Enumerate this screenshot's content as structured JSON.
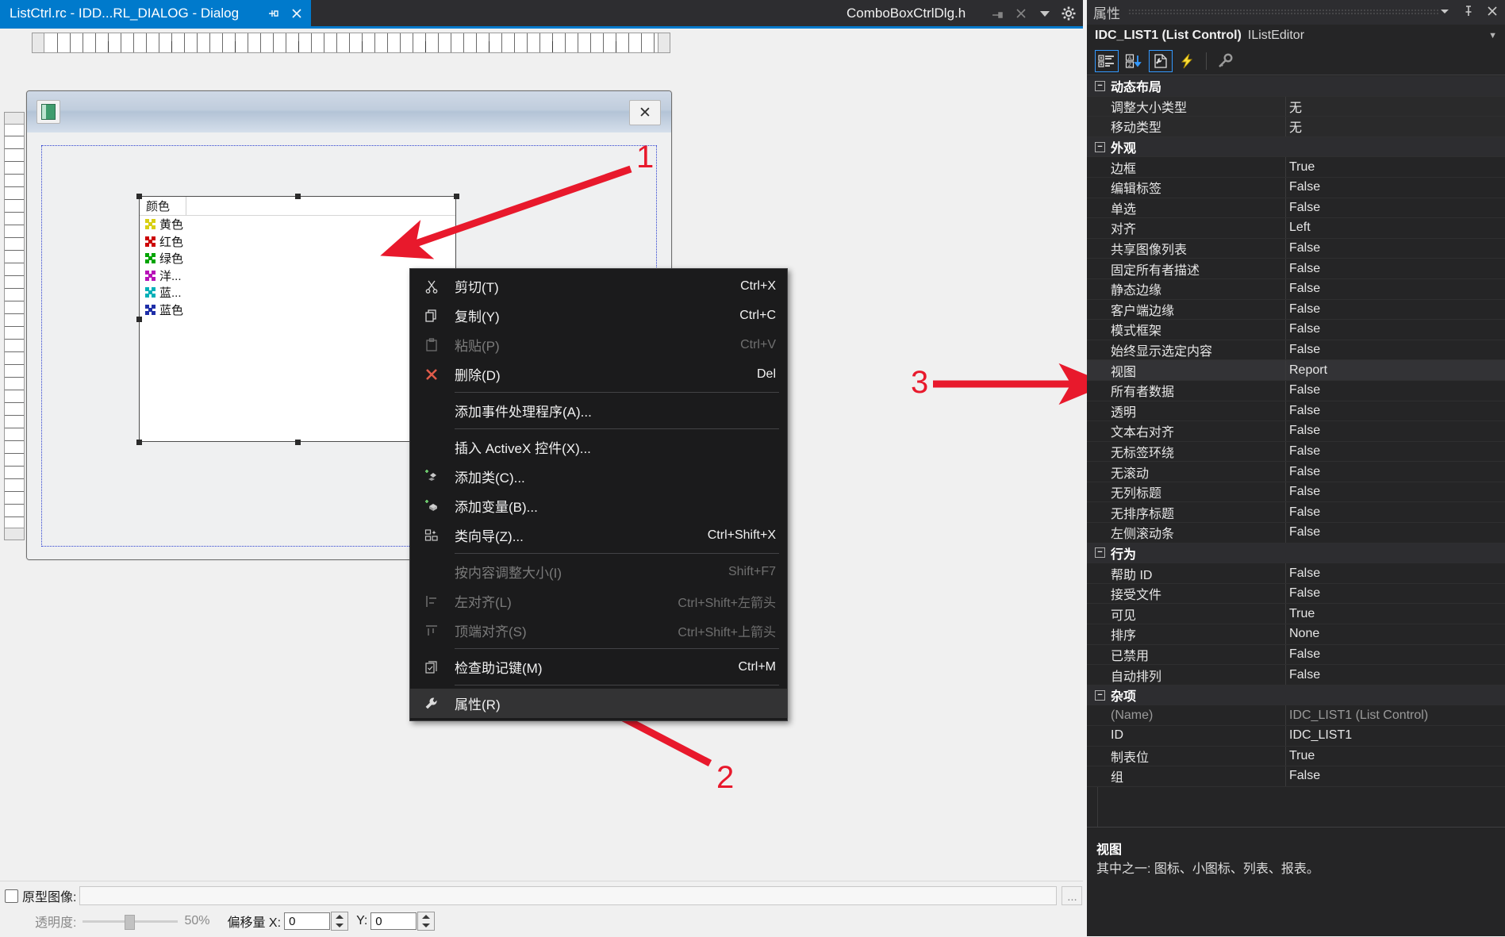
{
  "tabs": {
    "active": {
      "label": "ListCtrl.rc - IDD...RL_DIALOG - Dialog",
      "pin_icon": "pin-icon",
      "close_icon": "close-icon"
    },
    "inactive": {
      "label": "ComboBoxCtrlDlg.h",
      "pin_icon": "pin-icon",
      "close_icon": "close-icon",
      "dropdown_icon": "chevron-down-icon",
      "settings_icon": "gear-icon"
    }
  },
  "designer": {
    "dialog": {
      "system_icon": "app-icon",
      "close_button": "close-icon",
      "list_control": {
        "header": "颜色",
        "rows": [
          {
            "icon": "color-swatch-icon",
            "color": "#d8cf15",
            "label": "黄色"
          },
          {
            "icon": "color-swatch-icon",
            "color": "#cc0000",
            "label": "红色"
          },
          {
            "icon": "color-swatch-icon",
            "color": "#00a400",
            "label": "绿色"
          },
          {
            "icon": "color-swatch-icon",
            "color": "#b812b8",
            "label": "洋..."
          },
          {
            "icon": "color-swatch-icon",
            "color": "#00b0b8",
            "label": "蓝..."
          },
          {
            "icon": "color-swatch-icon",
            "color": "#1f2fa8",
            "label": "蓝色"
          }
        ]
      }
    },
    "annotations": [
      {
        "number": "1",
        "target": "list-control"
      },
      {
        "number": "2",
        "target": "context-menu-properties"
      },
      {
        "number": "3",
        "target": "view-property-row"
      }
    ]
  },
  "context_menu": {
    "items": [
      {
        "icon": "cut-icon",
        "label": "剪切(T)",
        "shortcut": "Ctrl+X",
        "disabled": false,
        "sep_after": false
      },
      {
        "icon": "copy-icon",
        "label": "复制(Y)",
        "shortcut": "Ctrl+C",
        "disabled": false,
        "sep_after": false
      },
      {
        "icon": "paste-icon",
        "label": "粘贴(P)",
        "shortcut": "Ctrl+V",
        "disabled": true,
        "sep_after": false
      },
      {
        "icon": "delete-x-icon",
        "label": "删除(D)",
        "shortcut": "Del",
        "disabled": false,
        "sep_after": true
      },
      {
        "icon": "",
        "label": "添加事件处理程序(A)...",
        "shortcut": "",
        "disabled": false,
        "sep_after": true
      },
      {
        "icon": "",
        "label": "插入 ActiveX 控件(X)...",
        "shortcut": "",
        "disabled": false,
        "sep_after": false
      },
      {
        "icon": "add-class-icon",
        "label": "添加类(C)...",
        "shortcut": "",
        "disabled": false,
        "sep_after": false
      },
      {
        "icon": "add-variable-icon",
        "label": "添加变量(B)...",
        "shortcut": "",
        "disabled": false,
        "sep_after": false
      },
      {
        "icon": "class-wizard-icon",
        "label": "类向导(Z)...",
        "shortcut": "Ctrl+Shift+X",
        "disabled": false,
        "sep_after": true
      },
      {
        "icon": "",
        "label": "按内容调整大小(I)",
        "shortcut": "Shift+F7",
        "disabled": true,
        "sep_after": false
      },
      {
        "icon": "align-left-icon",
        "label": "左对齐(L)",
        "shortcut": "Ctrl+Shift+左箭头",
        "disabled": true,
        "sep_after": false
      },
      {
        "icon": "align-top-icon",
        "label": "顶端对齐(S)",
        "shortcut": "Ctrl+Shift+上箭头",
        "disabled": true,
        "sep_after": true
      },
      {
        "icon": "check-mnemonic-icon",
        "label": "检查助记键(M)",
        "shortcut": "Ctrl+M",
        "disabled": false,
        "sep_after": true
      },
      {
        "icon": "wrench-icon",
        "label": "属性(R)",
        "shortcut": "",
        "disabled": false,
        "sep_after": false,
        "highlight": true
      }
    ]
  },
  "bottom_bar": {
    "prototype_checkbox_label": "原型图像:",
    "prototype_path": "",
    "browse_button": "...",
    "opacity_label": "透明度:",
    "opacity_value": "50%",
    "offset_label": "偏移量 X:",
    "offset_x": "0",
    "offset_y_label": "Y:",
    "offset_y": "0"
  },
  "properties_panel": {
    "title": "属性",
    "window_icons": {
      "dropdown": "chevron-down-icon",
      "pin": "pin-icon",
      "close": "close-icon"
    },
    "selected_object": "IDC_LIST1 (List Control)",
    "selected_object_extra": "IListEditor",
    "toolbar": [
      {
        "name": "categorized-view-icon",
        "selected": true
      },
      {
        "name": "alphabetical-sort-icon",
        "selected": false
      },
      {
        "name": "property-pages-icon",
        "selected": true
      },
      {
        "name": "events-lightning-icon",
        "selected": false
      },
      {
        "name": "property-key-icon",
        "selected": false
      }
    ],
    "groups": [
      {
        "name": "动态布局",
        "rows": [
          {
            "name": "调整大小类型",
            "value": "无"
          },
          {
            "name": "移动类型",
            "value": "无"
          }
        ]
      },
      {
        "name": "外观",
        "rows": [
          {
            "name": "边框",
            "value": "True"
          },
          {
            "name": "编辑标签",
            "value": "False"
          },
          {
            "name": "单选",
            "value": "False"
          },
          {
            "name": "对齐",
            "value": "Left"
          },
          {
            "name": "共享图像列表",
            "value": "False"
          },
          {
            "name": "固定所有者描述",
            "value": "False"
          },
          {
            "name": "静态边缘",
            "value": "False"
          },
          {
            "name": "客户端边缘",
            "value": "False"
          },
          {
            "name": "模式框架",
            "value": "False"
          },
          {
            "name": "始终显示选定内容",
            "value": "False"
          },
          {
            "name": "视图",
            "value": "Report",
            "selected": true
          },
          {
            "name": "所有者数据",
            "value": "False"
          },
          {
            "name": "透明",
            "value": "False"
          },
          {
            "name": "文本右对齐",
            "value": "False"
          },
          {
            "name": "无标签环绕",
            "value": "False"
          },
          {
            "name": "无滚动",
            "value": "False"
          },
          {
            "name": "无列标题",
            "value": "False"
          },
          {
            "name": "无排序标题",
            "value": "False"
          },
          {
            "name": "左侧滚动条",
            "value": "False"
          }
        ]
      },
      {
        "name": "行为",
        "rows": [
          {
            "name": "帮助 ID",
            "value": "False"
          },
          {
            "name": "接受文件",
            "value": "False"
          },
          {
            "name": "可见",
            "value": "True"
          },
          {
            "name": "排序",
            "value": "None"
          },
          {
            "name": "已禁用",
            "value": "False"
          },
          {
            "name": "自动排列",
            "value": "False"
          }
        ]
      },
      {
        "name": "杂项",
        "rows": [
          {
            "name": "(Name)",
            "value": "IDC_LIST1 (List Control)",
            "dim": true
          },
          {
            "name": "ID",
            "value": "IDC_LIST1"
          },
          {
            "name": "制表位",
            "value": "True"
          },
          {
            "name": "组",
            "value": "False"
          }
        ]
      }
    ],
    "description": {
      "title": "视图",
      "text": "其中之一: 图标、小图标、列表、报表。"
    }
  },
  "colors": {
    "accent": "#007acc",
    "panel_bg": "#252526",
    "annotation_red": "#e8192c"
  }
}
